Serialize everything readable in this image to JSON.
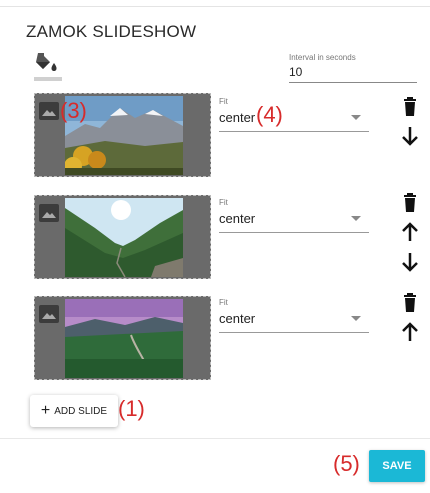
{
  "title": "ZAMOK SLIDESHOW",
  "interval": {
    "label": "Interval in seconds",
    "value": "10"
  },
  "slides": [
    {
      "fit_label": "Fit",
      "fit_value": "center",
      "actions": [
        "trash-icon",
        "arrow-down-icon"
      ]
    },
    {
      "fit_label": "Fit",
      "fit_value": "center",
      "actions": [
        "trash-icon",
        "arrow-up-icon",
        "arrow-down-icon"
      ]
    },
    {
      "fit_label": "Fit",
      "fit_value": "center",
      "actions": [
        "trash-icon",
        "arrow-up-icon"
      ]
    }
  ],
  "add_slide_label": "ADD SLIDE",
  "save_label": "SAVE",
  "annotations": {
    "a1": "(1)",
    "a3": "(3)",
    "a4": "(4)",
    "a5": "(5)"
  },
  "colors": {
    "accent": "#1bb8d6",
    "annotation": "#d72b2b",
    "slide_bg": "#6a6a6a"
  }
}
